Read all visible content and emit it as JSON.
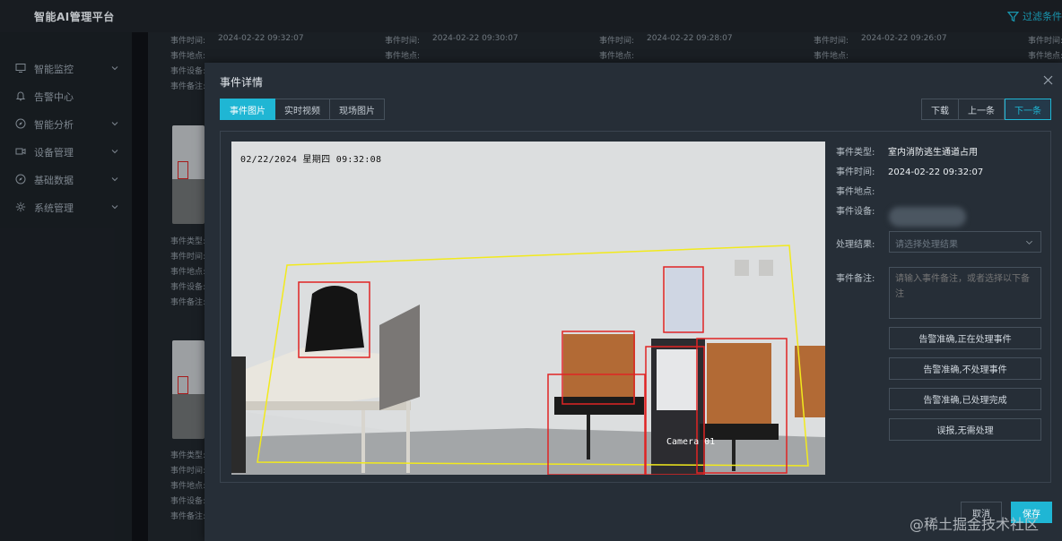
{
  "app": {
    "title": "智能AI管理平台",
    "filter_label": "过滤条件"
  },
  "sidebar": {
    "items": [
      {
        "label": "智能监控",
        "icon": "monitor-icon"
      },
      {
        "label": "告警中心",
        "icon": "bell-icon"
      },
      {
        "label": "智能分析",
        "icon": "compass-icon"
      },
      {
        "label": "设备管理",
        "icon": "camera-icon"
      },
      {
        "label": "基础数据",
        "icon": "compass-icon"
      },
      {
        "label": "系统管理",
        "icon": "gear-icon"
      }
    ]
  },
  "background_cards": {
    "top_row": [
      {
        "time_label": "事件时间:",
        "time": "2024-02-22 09:32:07",
        "place_label": "事件地点:"
      },
      {
        "time_label": "事件时间:",
        "time": "2024-02-22 09:30:07",
        "place_label": "事件地点:"
      },
      {
        "time_label": "事件时间:",
        "time": "2024-02-22 09:28:07",
        "place_label": "事件地点:"
      },
      {
        "time_label": "事件时间:",
        "time": "2024-02-22 09:26:07",
        "place_label": "事件地点:"
      },
      {
        "time_label": "事件时间:",
        "time": "",
        "place_label": "事件地点:"
      }
    ],
    "left_col_labels_top": [
      "事件设备:",
      "事件备注:"
    ],
    "left_col_labels_mid": [
      "事件类型:",
      "事件时间:",
      "事件地点:",
      "事件设备:",
      "事件备注:"
    ],
    "left_col_labels_bottom": [
      "事件类型:",
      "事件时间:",
      "事件地点:",
      "事件设备:",
      "事件备注:"
    ]
  },
  "modal": {
    "title": "事件详情",
    "tabs": [
      {
        "label": "事件图片",
        "active": true
      },
      {
        "label": "实时视频",
        "active": false
      },
      {
        "label": "现场图片",
        "active": false
      }
    ],
    "nav": {
      "download": "下载",
      "prev": "上一条",
      "next": "下一条"
    },
    "camera": {
      "timestamp": "02/22/2024 星期四 09:32:08",
      "label": "Camera 01"
    },
    "info": {
      "type_label": "事件类型:",
      "type_value": "室内消防逃生通道占用",
      "time_label": "事件时间:",
      "time_value": "2024-02-22 09:32:07",
      "place_label": "事件地点:",
      "place_value": "",
      "device_label": "事件设备:",
      "result_label": "处理结果:",
      "result_placeholder": "请选择处理结果",
      "remark_label": "事件备注:",
      "remark_placeholder": "请输入事件备注，或者选择以下备注"
    },
    "quick_remarks": [
      "告警准确,正在处理事件",
      "告警准确,不处理事件",
      "告警准确,已处理完成",
      "误报,无需处理"
    ],
    "footer": {
      "cancel": "取消",
      "save": "保存"
    }
  },
  "watermark": "@稀土掘金技术社区",
  "colors": {
    "accent": "#1fb6d4",
    "detection_box": "#e02424",
    "zone_line": "#f2ea1c"
  }
}
